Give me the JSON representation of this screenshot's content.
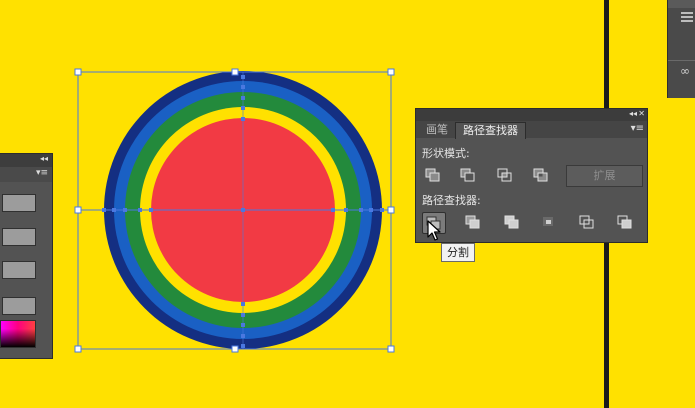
{
  "pathfinder_panel": {
    "tabs": [
      {
        "label": "画笔",
        "active": false
      },
      {
        "label": "路径查找器",
        "active": true
      }
    ],
    "collapse_glyph": "◂◂",
    "close_glyph": "✕",
    "menu_glyph": "▾≡",
    "shape_modes_label": "形状模式:",
    "pathfinders_label": "路径查找器:",
    "expand_label": "扩展",
    "shape_mode_buttons": [
      "unite-icon",
      "minus-front-icon",
      "intersect-icon",
      "exclude-icon"
    ],
    "pathfinder_buttons": [
      "divide-icon",
      "trim-icon",
      "merge-icon",
      "crop-icon",
      "outline-icon",
      "minus-back-icon"
    ]
  },
  "tooltip": {
    "text": "分割"
  },
  "left_panel": {
    "collapse_glyph": "◂◂",
    "menu_glyph": "▾≡"
  },
  "artwork": {
    "background_color": "#ffe100",
    "rings": [
      "#142f82",
      "#1a60c4",
      "#238a3c",
      "#ffe100",
      "#f23a44"
    ]
  }
}
